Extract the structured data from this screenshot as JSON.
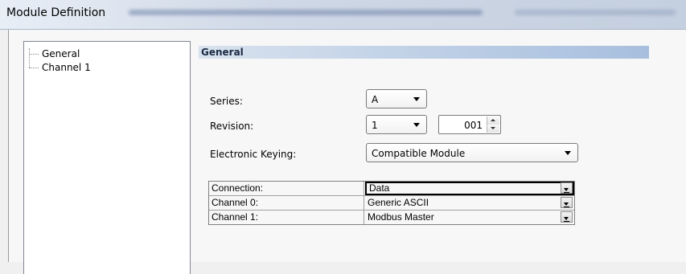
{
  "window": {
    "title": "Module Definition"
  },
  "tree": {
    "items": [
      {
        "label": "General"
      },
      {
        "label": "Channel 1"
      }
    ]
  },
  "general": {
    "heading": "General",
    "series": {
      "label": "Series:",
      "value": "A"
    },
    "revision": {
      "label": "Revision:",
      "major": "1",
      "minor": "001"
    },
    "keying": {
      "label": "Electronic Keying:",
      "value": "Compatible Module"
    },
    "grid": [
      {
        "name": "Connection:",
        "value": "Data"
      },
      {
        "name": "Channel 0:",
        "value": "Generic ASCII"
      },
      {
        "name": "Channel 1:",
        "value": "Modbus Master"
      }
    ]
  },
  "icons": {
    "dropdown": "chevron-down-icon",
    "spin_up": "spin-up-icon",
    "spin_down": "spin-down-icon"
  }
}
